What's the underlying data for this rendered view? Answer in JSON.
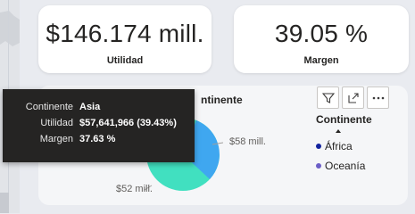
{
  "kpi_utilidad": {
    "value": "$146.174 mill.",
    "label": "Utilidad"
  },
  "kpi_margen": {
    "value": "39.05 %",
    "label": "Margen"
  },
  "visual": {
    "title_fragment": "ntinente",
    "pie_labels": [
      "$58 mill.",
      "$52 mill."
    ],
    "legend_title": "Continente",
    "legend": [
      {
        "label": "África",
        "color": "#12239e"
      },
      {
        "label": "Oceanía",
        "color": "#6b5ec7"
      }
    ],
    "icons": [
      "filter-icon",
      "focus-mode-icon",
      "more-options-icon"
    ]
  },
  "tooltip": {
    "rows": [
      {
        "key": "Continente",
        "value": "Asia"
      },
      {
        "key": "Utilidad",
        "value": "$57,641,966 (39.43%)"
      },
      {
        "key": "Margen",
        "value": "37.63 %"
      }
    ]
  },
  "colors": {
    "pie_teal": "#41e0c0",
    "pie_blue": "#3fa7f0",
    "tooltip_bg": "#252423"
  }
}
